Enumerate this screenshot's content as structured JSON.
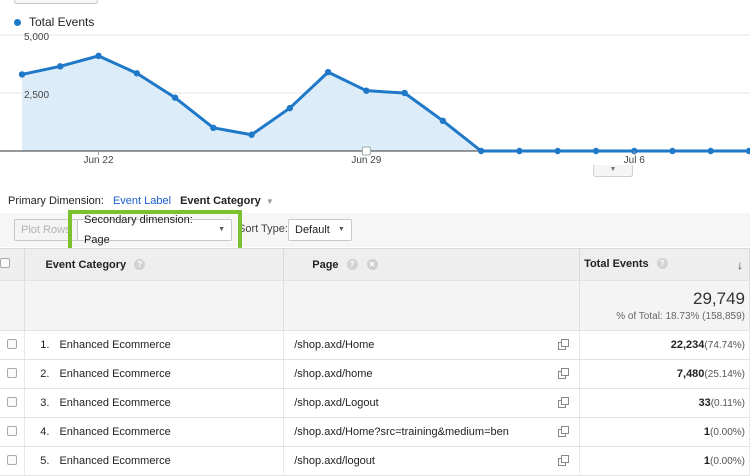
{
  "legend": {
    "label": "Total Events",
    "color": "#1f78c8"
  },
  "chart_data": {
    "type": "area",
    "series": [
      {
        "name": "Total Events",
        "values": [
          3300,
          3650,
          4100,
          3350,
          2300,
          1000,
          700,
          1850,
          3400,
          2600,
          2500,
          1300,
          0,
          0,
          0,
          0,
          0,
          0,
          0,
          0
        ]
      }
    ],
    "y_ticks": [
      "5,000",
      "2,500"
    ],
    "ylim": [
      0,
      5000
    ],
    "x_ticks": [
      "Jun 22",
      "Jun 29",
      "Jul 6"
    ],
    "line_color": "#1f78c8",
    "fill_color": "#dcedf9"
  },
  "primary_dimension": {
    "label": "Primary Dimension:",
    "option_link": "Event Label",
    "option_active": "Event Category"
  },
  "toolbar": {
    "plot_rows": "Plot Rows",
    "secondary_dimension": "Secondary dimension: Page",
    "sort_type_label": "Sort Type:",
    "sort_type_value": "Default"
  },
  "table": {
    "headers": {
      "category": "Event Category",
      "page": "Page",
      "total_events": "Total Events"
    },
    "totals": {
      "value": "29,749",
      "pct": "% of Total: 18.73% (158,859)"
    },
    "rows": [
      {
        "rank": "1.",
        "category": "Enhanced Ecommerce",
        "page": "/shop.axd/Home",
        "value": "22,234",
        "pct": "(74.74%)"
      },
      {
        "rank": "2.",
        "category": "Enhanced Ecommerce",
        "page": "/shop.axd/home",
        "value": "7,480",
        "pct": "(25.14%)"
      },
      {
        "rank": "3.",
        "category": "Enhanced Ecommerce",
        "page": "/shop.axd/Logout",
        "value": "33",
        "pct": "(0.11%)"
      },
      {
        "rank": "4.",
        "category": "Enhanced Ecommerce",
        "page": "/shop.axd/Home?src=training&medium=ben",
        "value": "1",
        "pct": "(0.00%)"
      },
      {
        "rank": "5.",
        "category": "Enhanced Ecommerce",
        "page": "/shop.axd/logout",
        "value": "1",
        "pct": "(0.00%)"
      }
    ]
  }
}
